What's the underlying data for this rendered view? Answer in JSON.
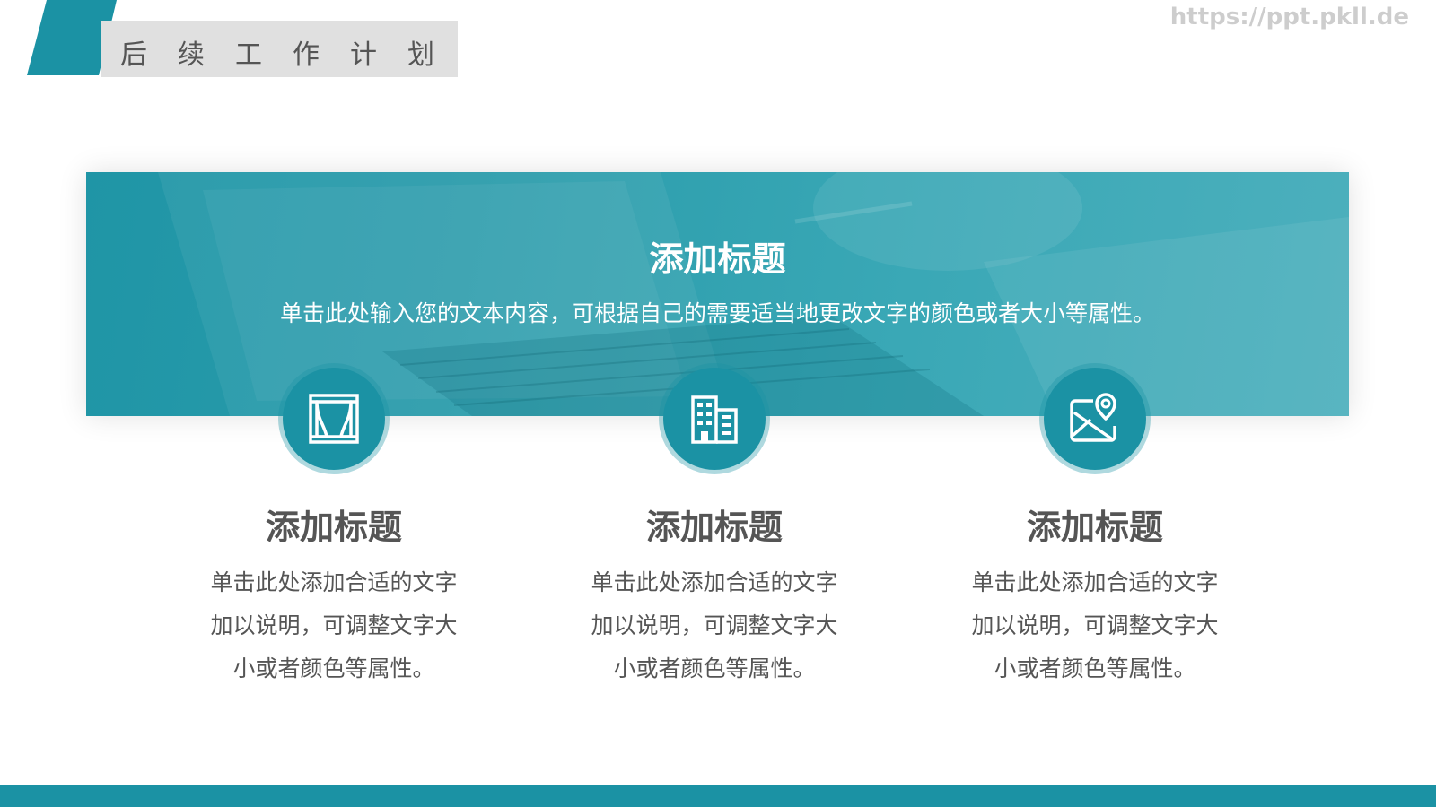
{
  "slide": {
    "title": "后续工作计划",
    "watermark": "https://ppt.pkll.de"
  },
  "banner": {
    "title": "添加标题",
    "description": "单击此处输入您的文本内容，可根据自己的需要适当地更改文字的颜色或者大小等属性。"
  },
  "columns": [
    {
      "icon": "curtain-icon",
      "title": "添加标题",
      "description": "单击此处添加合适的文字加以说明，可调整文字大小或者颜色等属性。"
    },
    {
      "icon": "building-icon",
      "title": "添加标题",
      "description": "单击此处添加合适的文字加以说明，可调整文字大小或者颜色等属性。"
    },
    {
      "icon": "map-pin-icon",
      "title": "添加标题",
      "description": "单击此处添加合适的文字加以说明，可调整文字大小或者颜色等属性。"
    }
  ],
  "colors": {
    "accent": "#1b92a4",
    "title_box": "#e0e0e0",
    "text": "#555555"
  }
}
